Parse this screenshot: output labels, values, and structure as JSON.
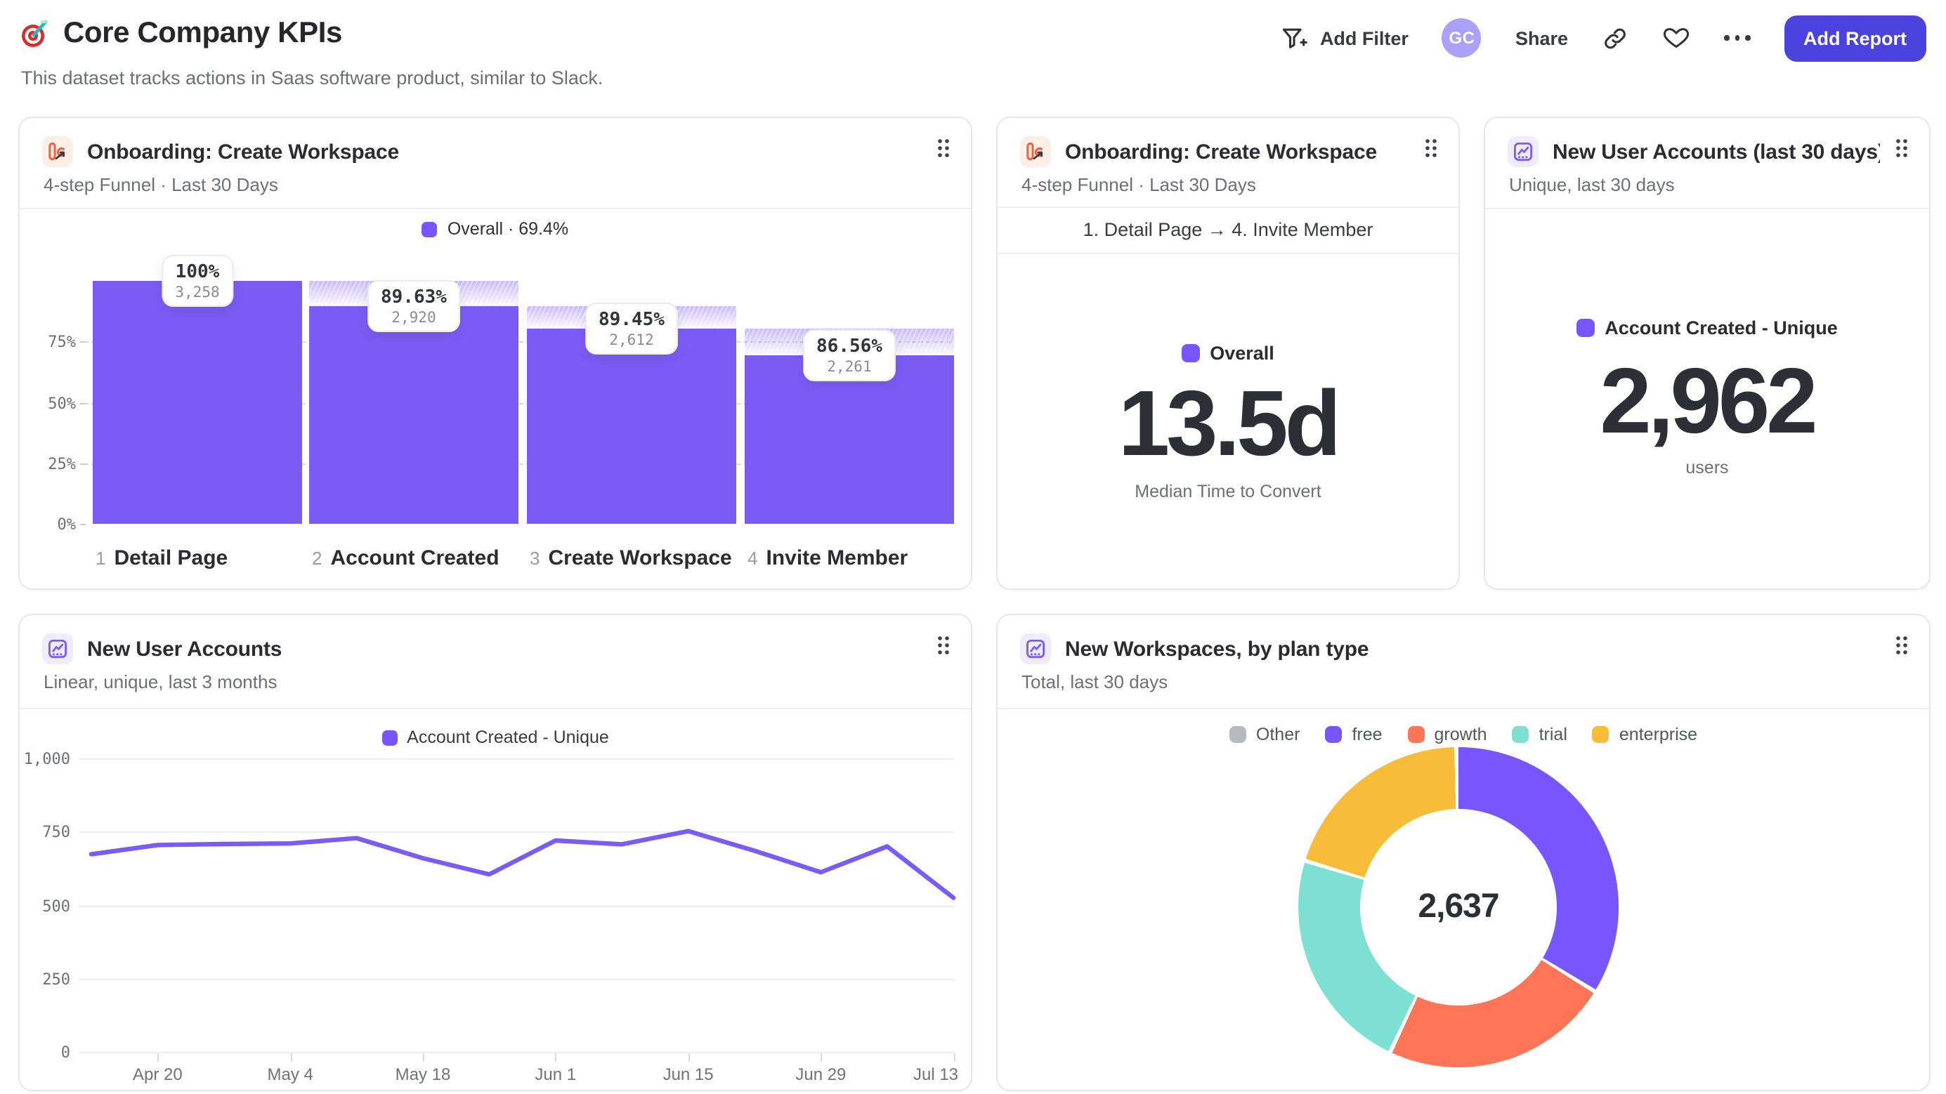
{
  "page": {
    "title": "Core Company KPIs",
    "subtitle": "This dataset tracks actions in Saas software product, similar to Slack."
  },
  "toolbar": {
    "add_filter_label": "Add Filter",
    "avatar_initials": "GC",
    "share_label": "Share",
    "add_report_label": "Add Report"
  },
  "colors": {
    "accent_purple": "#7856FF",
    "salmon": "#FF7557",
    "teal": "#7EE0D2",
    "yellow": "#F8BC3B",
    "gray": "#B8B8BF",
    "primary_button": "#4C43DF"
  },
  "cards": {
    "funnel": {
      "title": "Onboarding: Create Workspace",
      "subtitle": "4-step Funnel · Last 30 Days",
      "legend_label": "Overall · 69.4%"
    },
    "median": {
      "title": "Onboarding: Create Workspace",
      "subtitle": "4-step Funnel · Last 30 Days",
      "range": "1. Detail Page → 4. Invite Member",
      "legend_label": "Overall",
      "value": "13.5d",
      "caption": "Median Time to Convert"
    },
    "big": {
      "title": "New User Accounts (last 30 days)",
      "subtitle": "Unique, last 30 days",
      "legend_label": "Account Created - Unique",
      "value": "2,962",
      "caption": "users"
    },
    "line": {
      "title": "New User Accounts",
      "subtitle": "Linear, unique, last 3 months"
    },
    "donut": {
      "title": "New Workspaces, by plan type",
      "subtitle": "Total, last 30 days"
    }
  },
  "chart_data": [
    {
      "type": "bar",
      "subtype": "funnel",
      "title": "Onboarding: Create Workspace",
      "series_name": "Overall",
      "overall_conversion": "69.4%",
      "step_numbers": [
        "1",
        "2",
        "3",
        "4"
      ],
      "categories": [
        "Detail Page",
        "Account Created",
        "Create Workspace",
        "Invite Member"
      ],
      "values": [
        3258,
        2920,
        2612,
        2261
      ],
      "value_labels": [
        "3,258",
        "2,920",
        "2,612",
        "2,261"
      ],
      "conversion_pcts": [
        "100%",
        "89.63%",
        "89.45%",
        "86.56%"
      ],
      "ylabels": [
        "75%",
        "50%",
        "25%",
        "0%"
      ],
      "ytick_fracs": [
        0.75,
        0.5,
        0.25,
        0
      ],
      "ylim": [
        0,
        1
      ]
    },
    {
      "type": "line",
      "title": "New User Accounts",
      "series": [
        {
          "name": "Account Created - Unique",
          "values": [
            673,
            705,
            708,
            710,
            728,
            660,
            605,
            720,
            707,
            752,
            685,
            612,
            700,
            525
          ]
        }
      ],
      "x_tick_labels": [
        "Apr 20",
        "May 4",
        "May 18",
        "Jun 1",
        "Jun 15",
        "Jun 29",
        "Jul 13"
      ],
      "x_tick_indices": [
        1,
        3,
        5,
        7,
        9,
        11,
        13
      ],
      "yticks": [
        "1,000",
        "750",
        "500",
        "250",
        "0"
      ],
      "ytick_values": [
        1000,
        750,
        500,
        250,
        0
      ],
      "ylim": [
        0,
        1000
      ],
      "grid": true,
      "legend_position": "top"
    },
    {
      "type": "pie",
      "subtype": "donut",
      "title": "New Workspaces, by plan type",
      "total": 2637,
      "total_label": "2,637",
      "segments": [
        {
          "label": "Other",
          "value": 0,
          "color": "#B8B8BF"
        },
        {
          "label": "free",
          "value": 901,
          "color": "#7856FF"
        },
        {
          "label": "growth",
          "value": 611,
          "color": "#FF7557"
        },
        {
          "label": "trial",
          "value": 597,
          "color": "#7EE0D2"
        },
        {
          "label": "enterprise",
          "value": 528,
          "color": "#F8BC3B"
        }
      ],
      "legend_position": "top"
    }
  ]
}
